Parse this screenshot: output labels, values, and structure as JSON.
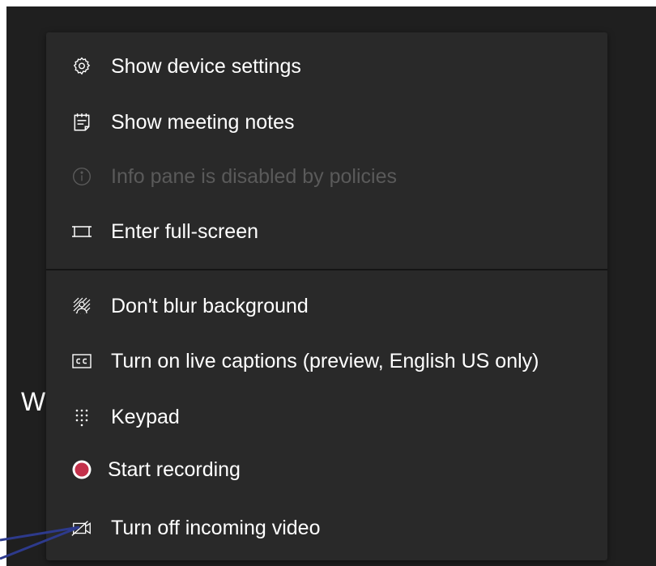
{
  "background": {
    "partial_text": "W"
  },
  "menu": {
    "items": [
      {
        "label": "Show device settings",
        "icon": "gear-icon",
        "enabled": true
      },
      {
        "label": "Show meeting notes",
        "icon": "notes-icon",
        "enabled": true
      },
      {
        "label": "Info pane is disabled by policies",
        "icon": "info-icon",
        "enabled": false
      },
      {
        "label": "Enter full-screen",
        "icon": "fullscreen-icon",
        "enabled": true
      },
      {
        "label": "Don't blur background",
        "icon": "blur-background-icon",
        "enabled": true
      },
      {
        "label": "Turn on live captions (preview, English US only)",
        "icon": "closed-captions-icon",
        "enabled": true
      },
      {
        "label": "Keypad",
        "icon": "keypad-icon",
        "enabled": true
      },
      {
        "label": "Start recording",
        "icon": "record-icon",
        "enabled": true
      },
      {
        "label": "Turn off incoming video",
        "icon": "video-off-icon",
        "enabled": true
      }
    ]
  },
  "colors": {
    "menu_bg": "#292929",
    "app_bg": "#1f1f1f",
    "text": "#ffffff",
    "disabled_text": "#5a5a5a",
    "record_red": "#c4314b",
    "callout_line": "#2d3a8c"
  }
}
